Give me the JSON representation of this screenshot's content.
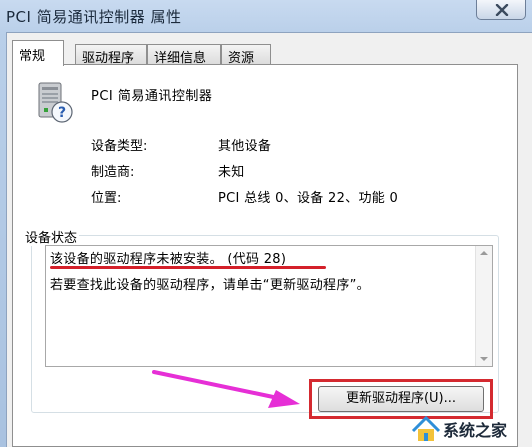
{
  "window": {
    "title": "PCI 简易通讯控制器 属性"
  },
  "tabs": [
    {
      "label": "常规",
      "active": true
    },
    {
      "label": "驱动程序",
      "active": false
    },
    {
      "label": "详细信息",
      "active": false
    },
    {
      "label": "资源",
      "active": false
    }
  ],
  "device": {
    "name": "PCI 简易通讯控制器",
    "icon": "unknown-device-icon",
    "properties": [
      {
        "label": "设备类型:",
        "value": "其他设备"
      },
      {
        "label": "制造商:",
        "value": "未知"
      },
      {
        "label": "位置:",
        "value": "PCI 总线 0、设备 22、功能 0"
      }
    ]
  },
  "status": {
    "legend": "设备状态",
    "lines": [
      "该设备的驱动程序未被安装。 (代码 28)",
      "若要查找此设备的驱动程序，请单击“更新驱动程序”。"
    ]
  },
  "buttons": {
    "update_driver": "更新驱动程序(U)..."
  },
  "watermark": {
    "text": "系统之家"
  },
  "colors": {
    "highlight_red": "#d42a30",
    "arrow_magenta": "#e62fd6"
  }
}
